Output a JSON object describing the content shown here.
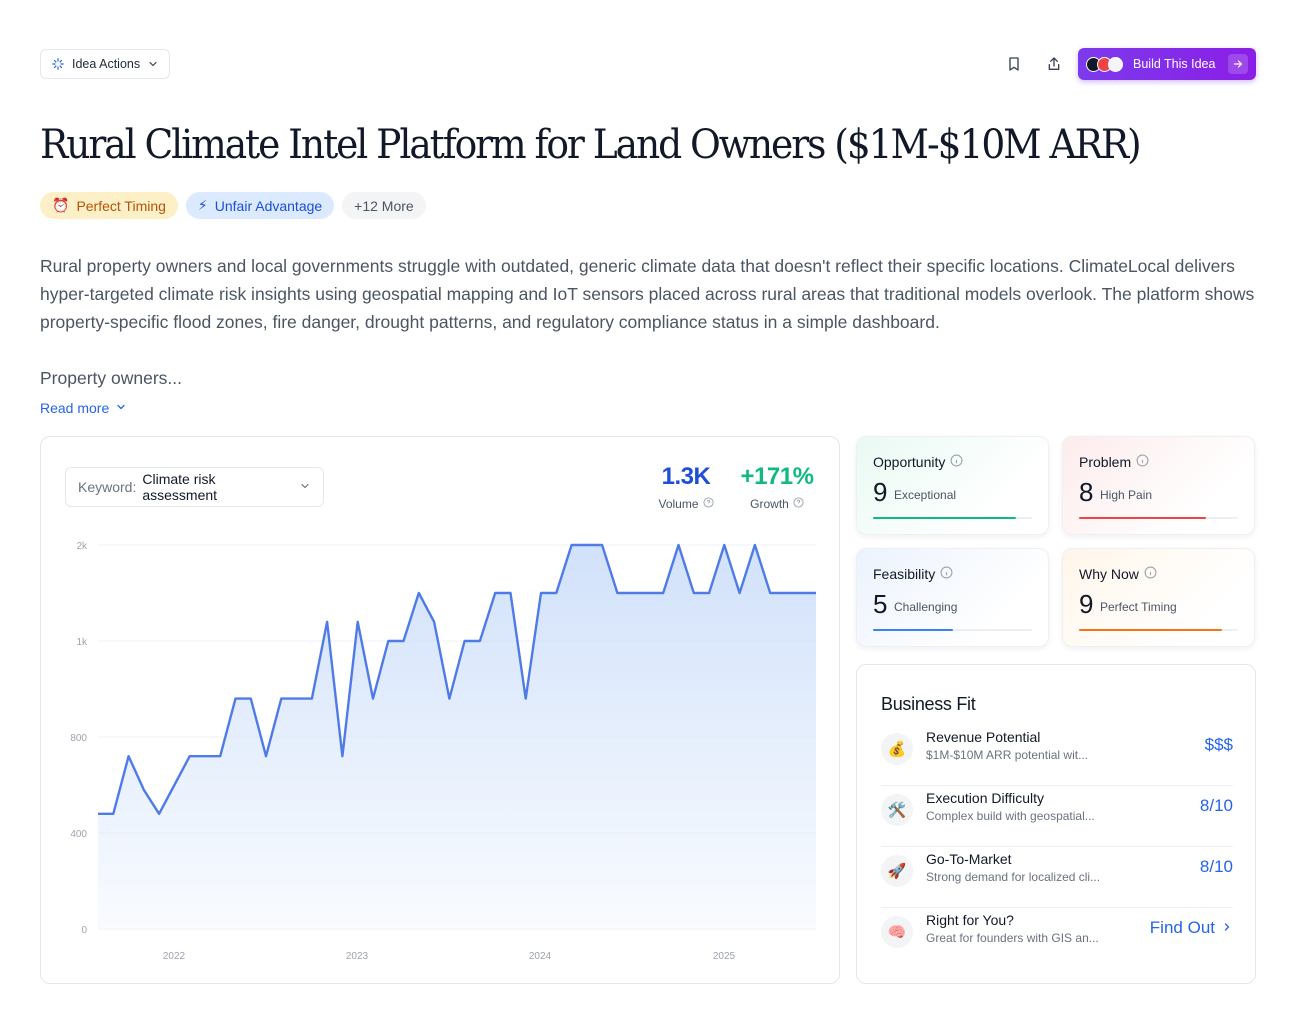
{
  "header": {
    "idea_actions_label": "Idea Actions",
    "build_label": "Build This Idea"
  },
  "title": "Rural Climate Intel Platform for Land Owners ($1M-$10M ARR)",
  "tags": [
    {
      "icon": "alarm-clock-icon",
      "emoji": "⏰",
      "label": "Perfect Timing"
    },
    {
      "icon": "lightning-icon",
      "emoji": "⚡",
      "label": "Unfair Advantage"
    },
    {
      "label": "+12 More"
    }
  ],
  "description": "Rural property owners and local governments struggle with outdated, generic climate data that doesn't reflect their specific locations. ClimateLocal delivers hyper-targeted climate risk insights using geospatial mapping and IoT sensors placed across rural areas that traditional models overlook. The platform shows property-specific flood zones, fire danger, drought patterns, and regulatory compliance status in a simple dashboard.",
  "description_more": "Property owners...",
  "read_more": "Read more",
  "keyword": {
    "label": "Keyword:",
    "value": "Climate risk assessment"
  },
  "stats": {
    "volume": {
      "value": "1.3K",
      "label": "Volume",
      "color": "#1d4ed8"
    },
    "growth": {
      "value": "+171%",
      "label": "Growth",
      "color": "#10b981"
    }
  },
  "chart_data": {
    "type": "area",
    "y_tick_labels": [
      "0",
      "400",
      "800",
      "1k",
      "2k"
    ],
    "x_tick_labels": [
      "2022",
      "2023",
      "2024",
      "2025"
    ],
    "x": [
      "2021-10",
      "2021-11",
      "2021-12",
      "2022-01",
      "2022-02",
      "2022-03",
      "2022-04",
      "2022-05",
      "2022-06",
      "2022-07",
      "2022-08",
      "2022-09",
      "2022-10",
      "2022-11",
      "2022-12",
      "2023-01",
      "2023-02",
      "2023-03",
      "2023-04",
      "2023-05",
      "2023-06",
      "2023-07",
      "2023-08",
      "2023-09",
      "2023-10",
      "2023-11",
      "2023-12",
      "2024-01",
      "2024-02",
      "2024-03",
      "2024-04",
      "2024-05",
      "2024-06",
      "2024-07",
      "2024-08",
      "2024-09",
      "2024-10",
      "2024-11",
      "2024-12",
      "2025-01",
      "2025-02",
      "2025-03",
      "2025-04",
      "2025-05",
      "2025-06",
      "2025-07",
      "2025-08",
      "2025-09"
    ],
    "values": [
      480,
      480,
      720,
      580,
      480,
      600,
      720,
      720,
      720,
      880,
      880,
      720,
      880,
      880,
      880,
      1200,
      720,
      1200,
      880,
      1000,
      1000,
      1500,
      1200,
      880,
      1000,
      1000,
      1500,
      1500,
      880,
      1500,
      1500,
      2000,
      2000,
      2000,
      1500,
      1500,
      1500,
      1500,
      2000,
      1500,
      1500,
      2000,
      1500,
      2000,
      1500,
      1500,
      1500,
      1500
    ],
    "line_color": "#4f7be8",
    "fill_color": "#cfe0fa"
  },
  "scores": [
    {
      "title": "Opportunity",
      "value": "9",
      "word": "Exceptional",
      "fraction": 0.9,
      "color": "#10b981",
      "bg": "#eafaf3"
    },
    {
      "title": "Problem",
      "value": "8",
      "word": "High Pain",
      "fraction": 0.8,
      "color": "#ef4444",
      "bg": "#fdecec"
    },
    {
      "title": "Feasibility",
      "value": "5",
      "word": "Challenging",
      "fraction": 0.5,
      "color": "#3b82f6",
      "bg": "#ecf3fd"
    },
    {
      "title": "Why Now",
      "value": "9",
      "word": "Perfect Timing",
      "fraction": 0.9,
      "color": "#f97316",
      "bg": "#fff6ea"
    }
  ],
  "business_fit": {
    "title": "Business Fit",
    "rows": [
      {
        "icon": "money-bag-icon",
        "emoji": "💰",
        "name": "Revenue Potential",
        "sub": "$1M-$10M ARR potential wit...",
        "value": "$$$"
      },
      {
        "icon": "tools-icon",
        "emoji": "🛠️",
        "name": "Execution Difficulty",
        "sub": "Complex build with geospatial...",
        "value": "8/10"
      },
      {
        "icon": "rocket-icon",
        "emoji": "🚀",
        "name": "Go-To-Market",
        "sub": "Strong demand for localized cli...",
        "value": "8/10"
      },
      {
        "icon": "brain-icon",
        "emoji": "🧠",
        "name": "Right for You?",
        "sub": "Great for founders with GIS an...",
        "value": "Find Out"
      }
    ]
  }
}
